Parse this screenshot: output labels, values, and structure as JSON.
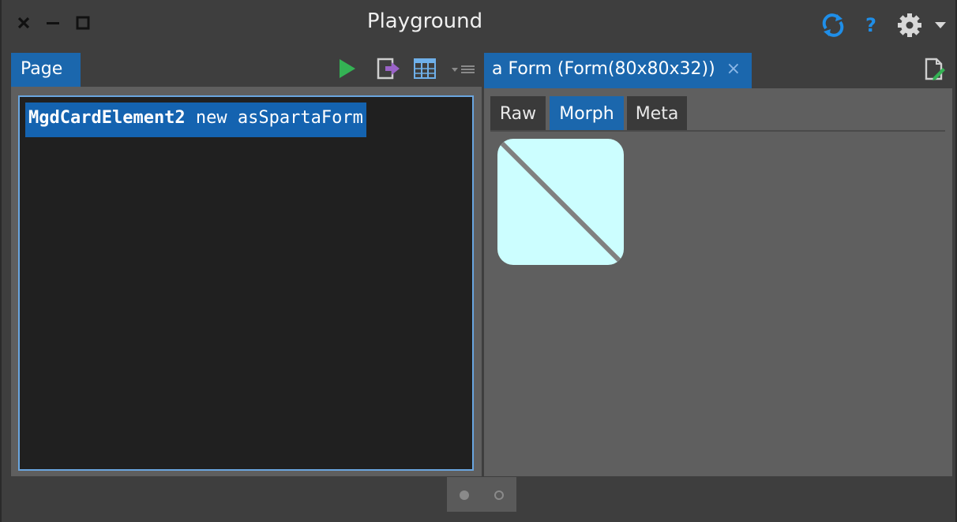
{
  "window": {
    "title": "Playground"
  },
  "titlebar_icons": {
    "close": "close-icon",
    "minimize": "minimize-icon",
    "maximize": "maximize-icon",
    "sync": "sync-icon",
    "help": "?",
    "settings": "gear-icon",
    "menu": "chevron-down-icon"
  },
  "left": {
    "tab_label": "Page",
    "toolbar": [
      "play-icon",
      "export-icon",
      "columns-icon",
      "options-menu-icon"
    ],
    "code": {
      "class_name": "MgdCardElement2",
      "rest": " new asSpartaForm"
    }
  },
  "right": {
    "tab_label": "a Form (Form(80x80x32))",
    "tab_close": "×",
    "subtabs": [
      "Raw",
      "Morph",
      "Meta"
    ],
    "active_subtab": "Morph",
    "preview": {
      "fill": "#ccfeff",
      "line": "#808080"
    }
  },
  "pager": {
    "pages": 2,
    "current": 1
  },
  "colors": {
    "accent": "#1b67ad",
    "background": "#3e3e3e",
    "editor_bg": "#202020",
    "play_green": "#34b254",
    "sync_blue": "#1f8ee8"
  }
}
